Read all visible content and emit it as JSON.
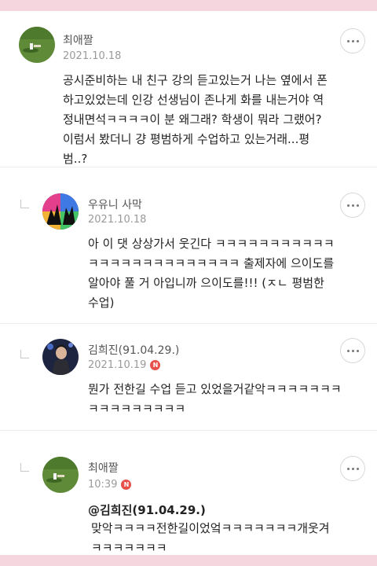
{
  "comments": [
    {
      "author": "최애짤",
      "date": "2021.10.18",
      "new": false,
      "reply": false,
      "avatar": "field-photo-avatar",
      "text": "공시준비하는 내 친구 강의 듣고있는거 나는 옆에서 폰\n하고있었는데 인강 선생님이 존나게 화를 내는거야 역\n정내면석ㅋㅋㅋㅋ이 분 왜그래? 학생이 뭐라 그랬어?\n이럼서 봤더니 걍 평범하게 수업하고 있는거래...평\n범..?"
    },
    {
      "author": "우유니 사막",
      "date": "2021.10.18",
      "new": false,
      "reply": true,
      "avatar": "colorful-silhouette-avatar",
      "text": "아 이 댓 상상가서 웃긴다 ㅋㅋㅋㅋㅋㅋㅋㅋㅋㅋㅋ\nㅋㅋㅋㅋㅋㅋㅋㅋㅋㅋㅋㅋㅋㅋ 출제자에 으이도를\n알아야 풀 거 아입니까 으이도를!!! (ㅈㄴ 평범한\n수업)"
    },
    {
      "author": "김희진(91.04.29.)",
      "date": "2021.10.19",
      "new": true,
      "reply": true,
      "avatar": "stage-photo-avatar",
      "text": "뭔가 전한길 수업 듣고 있었을거같악ㅋㅋㅋㅋㅋㅋㅋ\nㅋㅋㅋㅋㅋㅋㅋㅋㅋ"
    },
    {
      "author": "최애짤",
      "date": "10:39",
      "new": true,
      "reply": true,
      "avatar": "field-photo-avatar",
      "mention": "@김희진(91.04.29.)",
      "text": "맞악ㅋㅋㅋㅋ전한길이었엌ㅋㅋㅋㅋㅋㅋㅋ개웃겨\nㅋㅋㅋㅋㅋㅋㅋ"
    }
  ],
  "labels": {
    "new_badge": "N"
  },
  "icons": {
    "more": "more-options-icon",
    "reply": "reply-indicator-icon"
  },
  "colors": {
    "badge": "#e8504a",
    "background_accent": "#f5d6de"
  }
}
